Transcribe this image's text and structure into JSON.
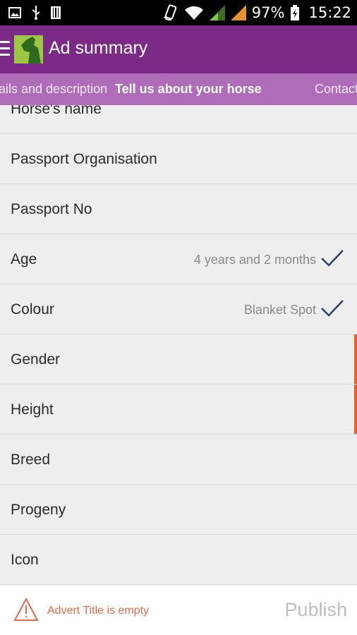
{
  "status_bar": {
    "battery": "97%",
    "time": "15:22",
    "icons": [
      "image-icon",
      "usb-icon",
      "barcode-icon",
      "rotate-icon",
      "wifi-icon",
      "signal-icon",
      "signal-icon",
      "battery-icon"
    ]
  },
  "app_bar": {
    "title": "Ad summary",
    "menu_icon": "hamburger-icon",
    "logo": "horse-logo"
  },
  "tabs": [
    {
      "label": "ails and description",
      "active": false
    },
    {
      "label": "Tell us about your horse",
      "active": true
    },
    {
      "label": "Contact",
      "active": false
    }
  ],
  "rows": [
    {
      "label": "Horse's name",
      "value": "",
      "checked": false,
      "warning": false
    },
    {
      "label": "Passport Organisation",
      "value": "",
      "checked": false,
      "warning": false
    },
    {
      "label": "Passport No",
      "value": "",
      "checked": false,
      "warning": false
    },
    {
      "label": "Age",
      "value": "4 years and 2 months",
      "checked": true,
      "warning": false
    },
    {
      "label": "Colour",
      "value": "Blanket Spot",
      "checked": true,
      "warning": false
    },
    {
      "label": "Gender",
      "value": "",
      "checked": false,
      "warning": true
    },
    {
      "label": "Height",
      "value": "",
      "checked": false,
      "warning": true
    },
    {
      "label": "Breed",
      "value": "",
      "checked": false,
      "warning": false
    },
    {
      "label": "Progeny",
      "value": "",
      "checked": false,
      "warning": false
    },
    {
      "label": "Icon",
      "value": "",
      "checked": false,
      "warning": false
    }
  ],
  "bottom_bar": {
    "warning_text": "Advert Title is empty",
    "publish_label": "Publish"
  },
  "colors": {
    "app_bar": "#7b2a86",
    "tab_strip": "#ae6cb9",
    "check": "#2a3f66",
    "warning": "#e0622a",
    "logo": "#9dc644"
  }
}
